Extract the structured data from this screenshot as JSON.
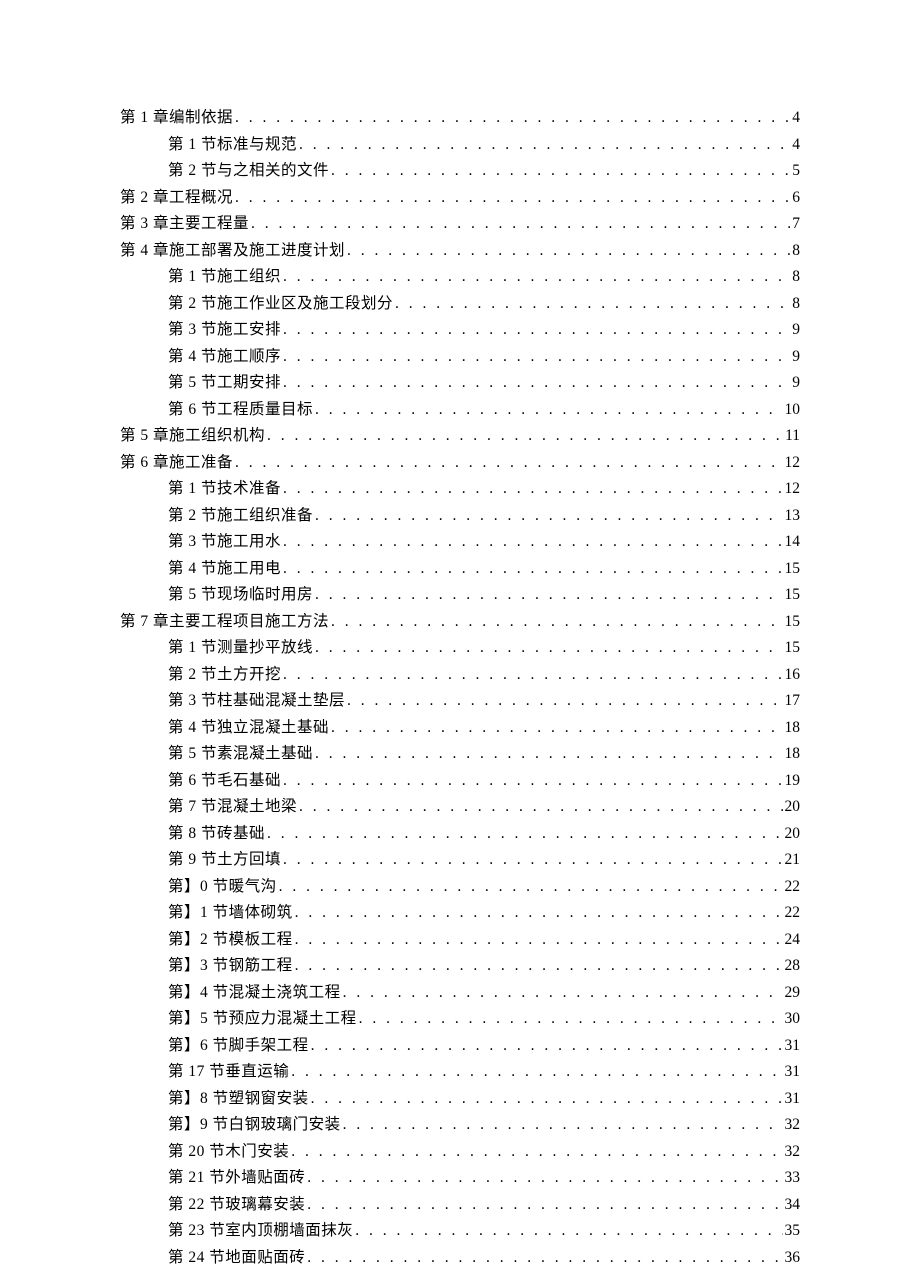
{
  "toc": [
    {
      "level": 1,
      "label": "第 1 章编制依据",
      "page": "4"
    },
    {
      "level": 2,
      "label": "第 1 节标准与规范",
      "page": "4"
    },
    {
      "level": 2,
      "label": "第 2 节与之相关的文件",
      "page": "5"
    },
    {
      "level": 1,
      "label": "第 2 章工程概况",
      "page": "6"
    },
    {
      "level": 1,
      "label": "第 3 章主要工程量",
      "page": "7"
    },
    {
      "level": 1,
      "label": "第 4 章施工部署及施工进度计划",
      "page": "8"
    },
    {
      "level": 2,
      "label": "第 1 节施工组织",
      "page": "8"
    },
    {
      "level": 2,
      "label": "第 2 节施工作业区及施工段划分",
      "page": "8"
    },
    {
      "level": 2,
      "label": "第 3 节施工安排",
      "page": "9"
    },
    {
      "level": 2,
      "label": "第 4 节施工顺序",
      "page": "9"
    },
    {
      "level": 2,
      "label": "第 5 节工期安排",
      "page": "9"
    },
    {
      "level": 2,
      "label": "第 6 节工程质量目标",
      "page": "10"
    },
    {
      "level": 1,
      "label": "第 5 章施工组织机构",
      "page": "11"
    },
    {
      "level": 1,
      "label": "第 6 章施工准备",
      "page": "12"
    },
    {
      "level": 2,
      "label": "第 1 节技术准备",
      "page": "12"
    },
    {
      "level": 2,
      "label": "第 2 节施工组织准备",
      "page": "13"
    },
    {
      "level": 2,
      "label": "第 3 节施工用水",
      "page": "14"
    },
    {
      "level": 2,
      "label": "第 4 节施工用电",
      "page": "15"
    },
    {
      "level": 2,
      "label": "第 5 节现场临时用房",
      "page": "15"
    },
    {
      "level": 1,
      "label": "第 7 章主要工程项目施工方法",
      "page": "15"
    },
    {
      "level": 2,
      "label": "第 1 节测量抄平放线",
      "page": "15"
    },
    {
      "level": 2,
      "label": "第 2 节土方开挖",
      "page": "16"
    },
    {
      "level": 2,
      "label": "第 3 节柱基础混凝土垫层",
      "page": "17"
    },
    {
      "level": 2,
      "label": "第 4 节独立混凝土基础",
      "page": "18"
    },
    {
      "level": 2,
      "label": "第 5 节素混凝土基础",
      "page": "18"
    },
    {
      "level": 2,
      "label": "第 6 节毛石基础",
      "page": "19"
    },
    {
      "level": 2,
      "label": "第 7 节混凝土地梁",
      "page": "20"
    },
    {
      "level": 2,
      "label": "第 8 节砖基础",
      "page": "20"
    },
    {
      "level": 2,
      "label": "第 9 节土方回填",
      "page": "21"
    },
    {
      "level": 2,
      "label": "第】0 节暖气沟",
      "page": "22"
    },
    {
      "level": 2,
      "label": "第】1 节墙体砌筑",
      "page": "22"
    },
    {
      "level": 2,
      "label": "第】2 节模板工程",
      "page": "24"
    },
    {
      "level": 2,
      "label": "第】3 节钢筋工程",
      "page": "28"
    },
    {
      "level": 2,
      "label": "第】4 节混凝土浇筑工程",
      "page": "29"
    },
    {
      "level": 2,
      "label": "第】5 节预应力混凝土工程",
      "page": "30"
    },
    {
      "level": 2,
      "label": "第】6 节脚手架工程",
      "page": "31"
    },
    {
      "level": 2,
      "label": "第 17 节垂直运输",
      "page": "31"
    },
    {
      "level": 2,
      "label": "第】8 节塑钢窗安装",
      "page": "31"
    },
    {
      "level": 2,
      "label": "第】9 节白钢玻璃门安装",
      "page": "32"
    },
    {
      "level": 2,
      "label": "第 20 节木门安装",
      "page": "32"
    },
    {
      "level": 2,
      "label": "第 21 节外墙贴面砖",
      "page": "33"
    },
    {
      "level": 2,
      "label": "第 22 节玻璃幕安装",
      "page": "34"
    },
    {
      "level": 2,
      "label": "第 23 节室内顶棚墙面抹灰",
      "page": "35"
    },
    {
      "level": 2,
      "label": "第 24 节地面贴面砖",
      "page": "36"
    }
  ]
}
